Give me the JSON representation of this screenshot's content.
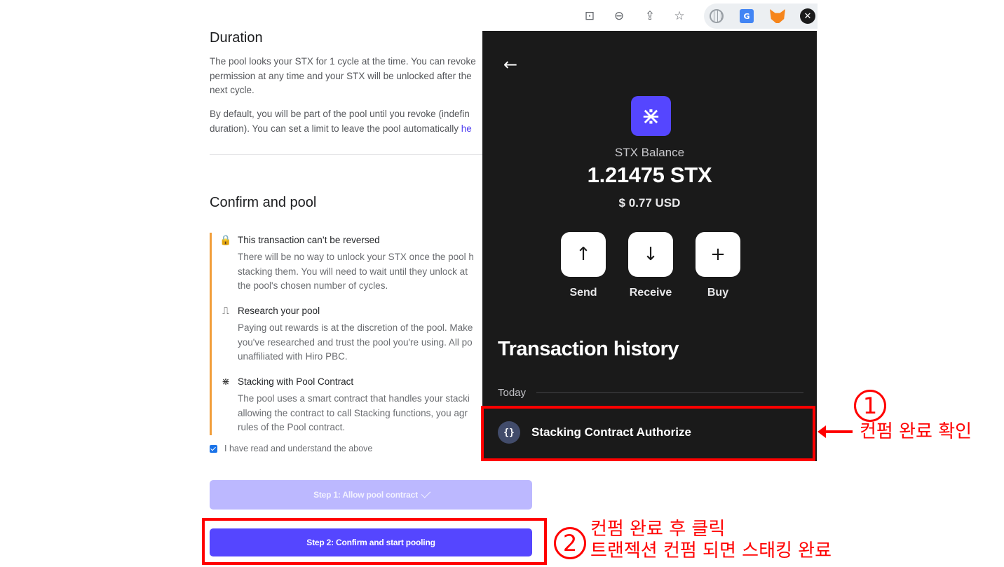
{
  "page": {
    "duration_title": "Duration",
    "duration_p1": "The pool looks your STX for 1 cycle at the time. You can revoke\npermission at any time and your STX will be unlocked after the\nnext cycle.",
    "duration_p2": "By default, you will be part of the pool until you revoke (indefin\nduration). You can set a limit to leave the pool automatically ",
    "duration_p2_link": "he",
    "confirm_title": "Confirm and pool",
    "warnings": [
      {
        "icon": "lock-icon",
        "glyph": "🔒",
        "title": "This transaction can’t be reversed",
        "text": "There will be no way to unlock your STX once the pool h\nstacking them. You will need to wait until they unlock at\nthe pool's chosen number of cycles."
      },
      {
        "icon": "steps-icon",
        "glyph": "⎍",
        "title": "Research your pool",
        "text": "Paying out rewards is at the discretion of the pool. Make\nyou've researched and trust the pool you're using. All po\nunaffiliated with Hiro PBC."
      },
      {
        "icon": "stacks-icon",
        "glyph": "⋇",
        "title": "Stacking with Pool Contract",
        "text": "The pool uses a smart contract that handles your stacki\nallowing the contract to call Stacking functions, you agr\nrules of the Pool contract."
      }
    ],
    "checkbox_label": "I have read and understand the above",
    "step1_label": "Step 1: Allow pool contract",
    "step2_label": "Step 2: Confirm and start pooling"
  },
  "wallet": {
    "back_icon": "←",
    "logo_glyph": "⋇",
    "balance_label": "STX Balance",
    "balance": "1.21475 STX",
    "usd": "$ 0.77 USD",
    "actions": [
      {
        "label": "Send",
        "glyph": "↑"
      },
      {
        "label": "Receive",
        "glyph": "↓"
      },
      {
        "label": "Buy",
        "glyph": "+"
      }
    ],
    "history_title": "Transaction history",
    "today_label": "Today",
    "tx_icon": "{}",
    "tx_label": "Stacking Contract Authorize"
  },
  "toolbar": {
    "icons": [
      "translate-icon",
      "zoom-out-icon",
      "share-icon",
      "star-icon",
      "globe-extension-icon",
      "google-translate-extension-icon",
      "metamask-extension-icon",
      "xverse-extension-icon"
    ]
  },
  "annotations": {
    "note1_num": "1",
    "note1_text": "컨펌 완료 확인",
    "note2_num": "2",
    "note2_text": "컨펌 완료 후 클릭\n트랜젝션 컨펌 되면 스태킹 완료",
    "color": "#ff0000"
  },
  "colors": {
    "primary": "#5546ff",
    "primary_disabled": "#bcb8ff",
    "warning": "#f19e3a",
    "wallet_bg": "#1a1a1a"
  }
}
